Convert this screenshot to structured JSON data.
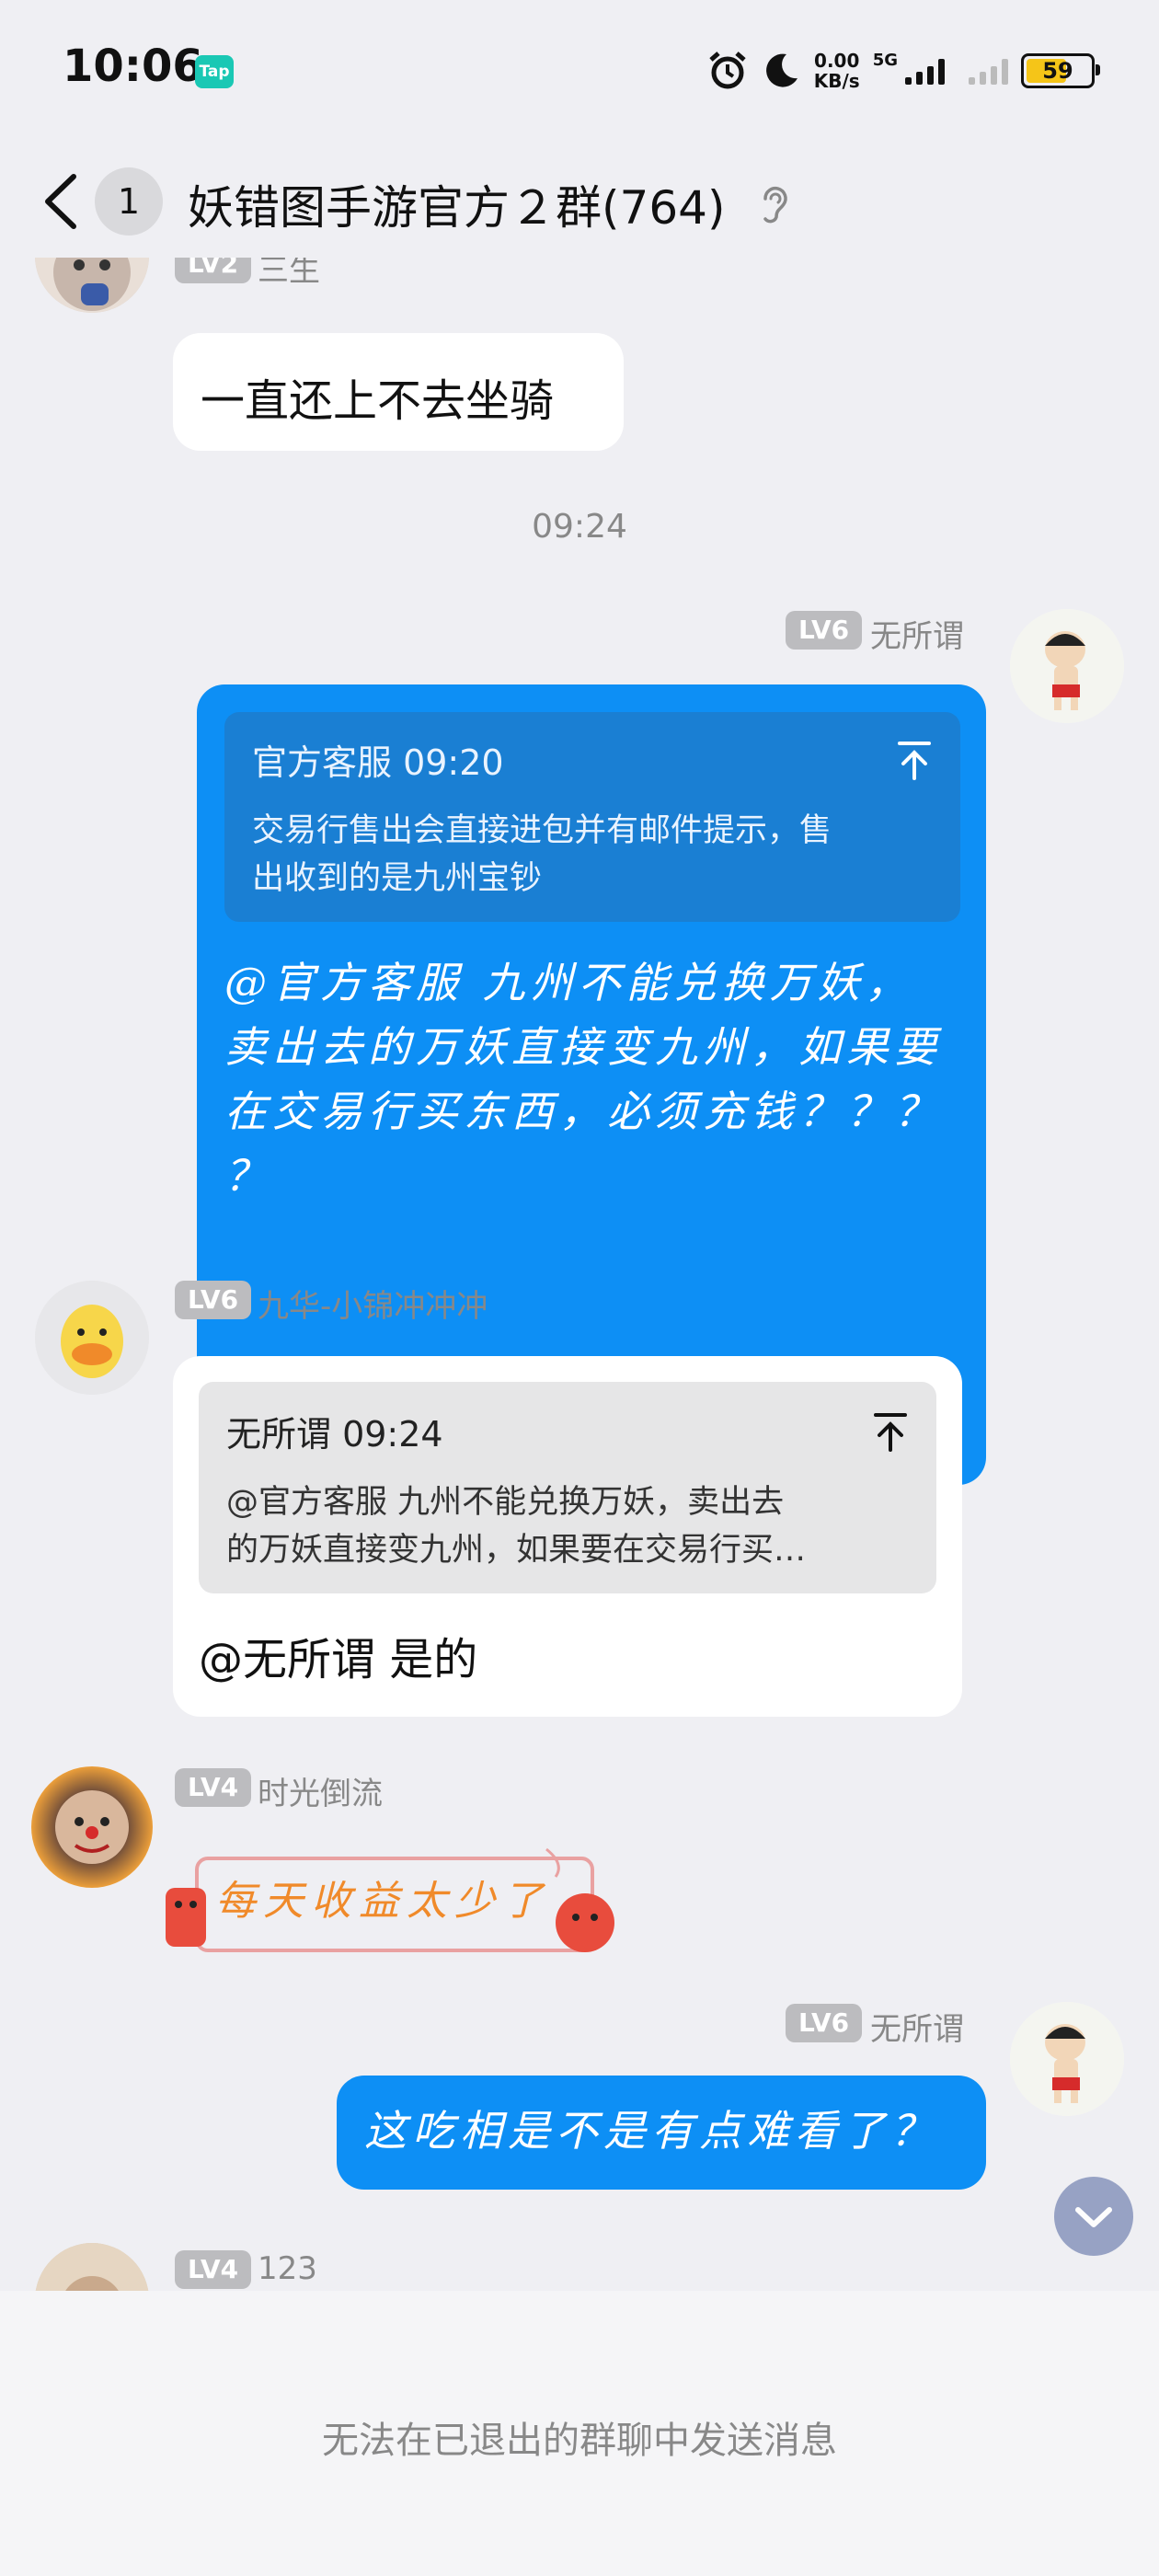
{
  "status_bar": {
    "time": "10:06",
    "app_badge": "Tap",
    "net_speed_value": "0.00",
    "net_speed_unit": "KB/s",
    "network": "5G",
    "battery": "59"
  },
  "header": {
    "unread_count": "1",
    "title": "妖错图手游官方２群(764)"
  },
  "messages": [
    {
      "level": "LV2",
      "name": "三生",
      "text": "一直还上不去坐骑"
    },
    {
      "timestamp": "09:24"
    },
    {
      "level": "LV6",
      "name": "无所谓",
      "quote_header": "官方客服 09:20",
      "quote_text_1": "交易行售出会直接进包并有邮件提示，售",
      "quote_text_2": "出收到的是九州宝钞",
      "line1": "@官方客服 九州不能兑换万妖，",
      "line2": "卖出去的万妖直接变九州，如果要",
      "line3": "在交易行买东西，必须充钱？？？",
      "line4": "？"
    },
    {
      "level": "LV6",
      "name": "九华-小锦冲冲冲",
      "quote_header": "无所谓 09:24",
      "quote_text_1": "@官方客服 九州不能兑换万妖，卖出去",
      "quote_text_2": "的万妖直接变九州，如果要在交易行买…",
      "text": "@无所谓 是的"
    },
    {
      "level": "LV4",
      "name": "时光倒流",
      "sticker_text": "每天收益太少了"
    },
    {
      "level": "LV6",
      "name": "无所谓",
      "text": "这吃相是不是有点难看了？"
    },
    {
      "level": "LV4",
      "name": "123"
    }
  ],
  "footer": {
    "notice": "无法在已退出的群聊中发送消息"
  },
  "colors": {
    "accent_blue": "#0d8ff5",
    "background": "#efeff3"
  }
}
